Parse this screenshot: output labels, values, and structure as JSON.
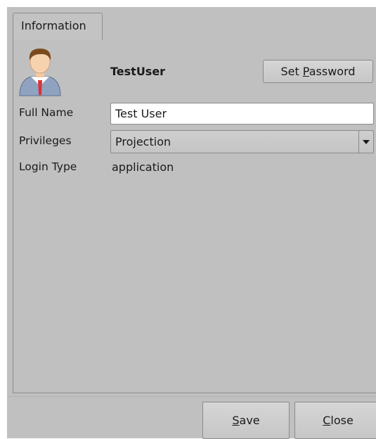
{
  "tabs": [
    {
      "label": "Information"
    }
  ],
  "user": {
    "username": "TestUser"
  },
  "buttons": {
    "set_password": {
      "before": "Set ",
      "mnemonic": "P",
      "after": "assword"
    },
    "save": {
      "before": "",
      "mnemonic": "S",
      "after": "ave"
    },
    "close": {
      "before": "",
      "mnemonic": "C",
      "after": "lose"
    }
  },
  "form": {
    "full_name": {
      "label": "Full Name",
      "value": "Test User"
    },
    "privileges": {
      "label": "Privileges",
      "value": "Projection"
    },
    "login_type": {
      "label": "Login Type",
      "value": "application"
    }
  },
  "icons": {
    "avatar": "user-avatar-icon",
    "dropdown": "chevron-down-icon"
  },
  "colors": {
    "window_bg": "#c0c0c0",
    "input_bg": "#ffffff",
    "border": "#8a8a8a"
  }
}
